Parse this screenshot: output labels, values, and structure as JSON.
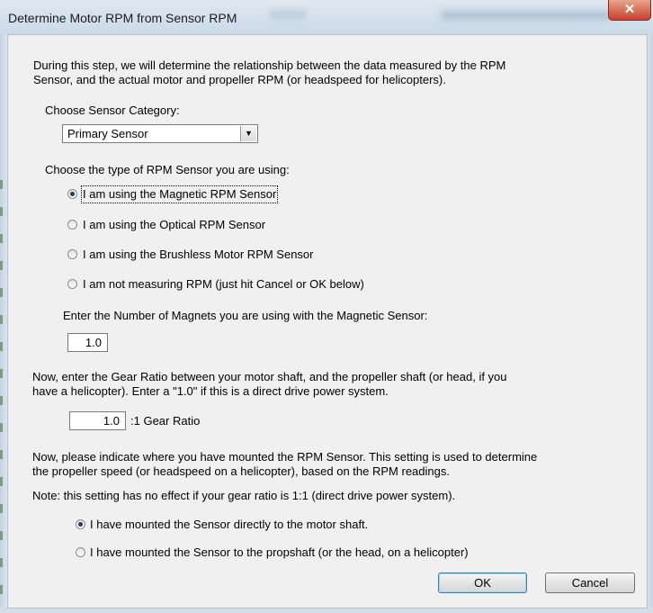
{
  "window": {
    "title": "Determine Motor RPM from Sensor RPM",
    "close_glyph": "✕"
  },
  "intro": {
    "line1": "During this step, we will determine the relationship between the data measured by the RPM",
    "line2": "Sensor, and the actual motor and propeller RPM (or headspeed for helicopters)."
  },
  "sensor_category": {
    "label": "Choose Sensor Category:",
    "selected": "Primary Sensor",
    "arrow_icon": "chevron-down-icon"
  },
  "sensor_type": {
    "label": "Choose the type of RPM Sensor you are using:",
    "options": [
      {
        "label": "I am using the Magnetic RPM Sensor",
        "checked": true
      },
      {
        "label": "I am using the Optical RPM Sensor",
        "checked": false
      },
      {
        "label": "I am using the Brushless Motor RPM Sensor",
        "checked": false
      },
      {
        "label": "I am not measuring RPM (just hit Cancel or OK below)",
        "checked": false
      }
    ]
  },
  "magnets": {
    "label": "Enter the Number of Magnets you are using with the Magnetic Sensor:",
    "value": "1.0"
  },
  "gear": {
    "line1": "Now, enter the Gear Ratio between your motor shaft, and the propeller shaft (or head, if you",
    "line2": "have a helicopter).    Enter a \"1.0\" if this is a direct drive power system.",
    "value": "1.0",
    "suffix": ":1 Gear Ratio"
  },
  "mount": {
    "line1": "Now, please indicate where you have mounted the RPM Sensor.   This setting is used to determine",
    "line2": "the propeller speed (or headspeed on a helicopter), based on the RPM readings.",
    "note": "Note: this setting has no effect if your gear ratio is 1:1 (direct drive power system).",
    "options": [
      {
        "label": "I have mounted the Sensor directly to the motor shaft.",
        "checked": true
      },
      {
        "label": "I have mounted the Sensor to the propshaft (or the head, on a helicopter)",
        "checked": false
      }
    ]
  },
  "buttons": {
    "ok": "OK",
    "cancel": "Cancel"
  }
}
